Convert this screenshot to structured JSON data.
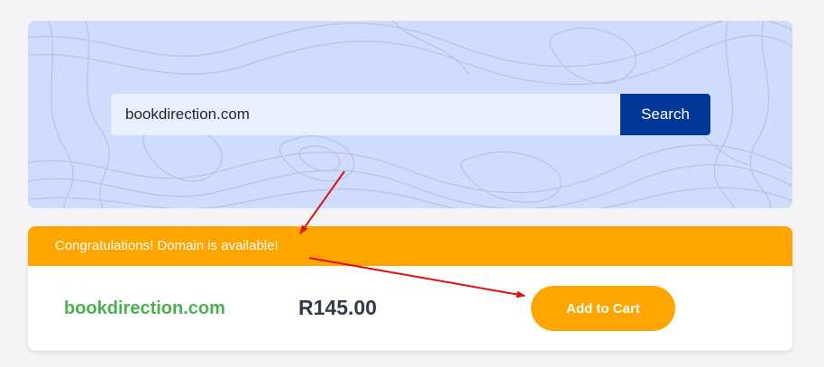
{
  "search": {
    "value": "bookdirection.com",
    "button_label": "Search"
  },
  "result": {
    "banner_text": "Congratulations! Domain is available!",
    "domain": "bookdirection.com",
    "price": "R145.00",
    "add_to_cart_label": "Add to Cart"
  },
  "colors": {
    "banner": "#ffa500",
    "search_button": "#02379a",
    "domain_text": "#4caf50",
    "annotation_arrows": "#e01010"
  }
}
